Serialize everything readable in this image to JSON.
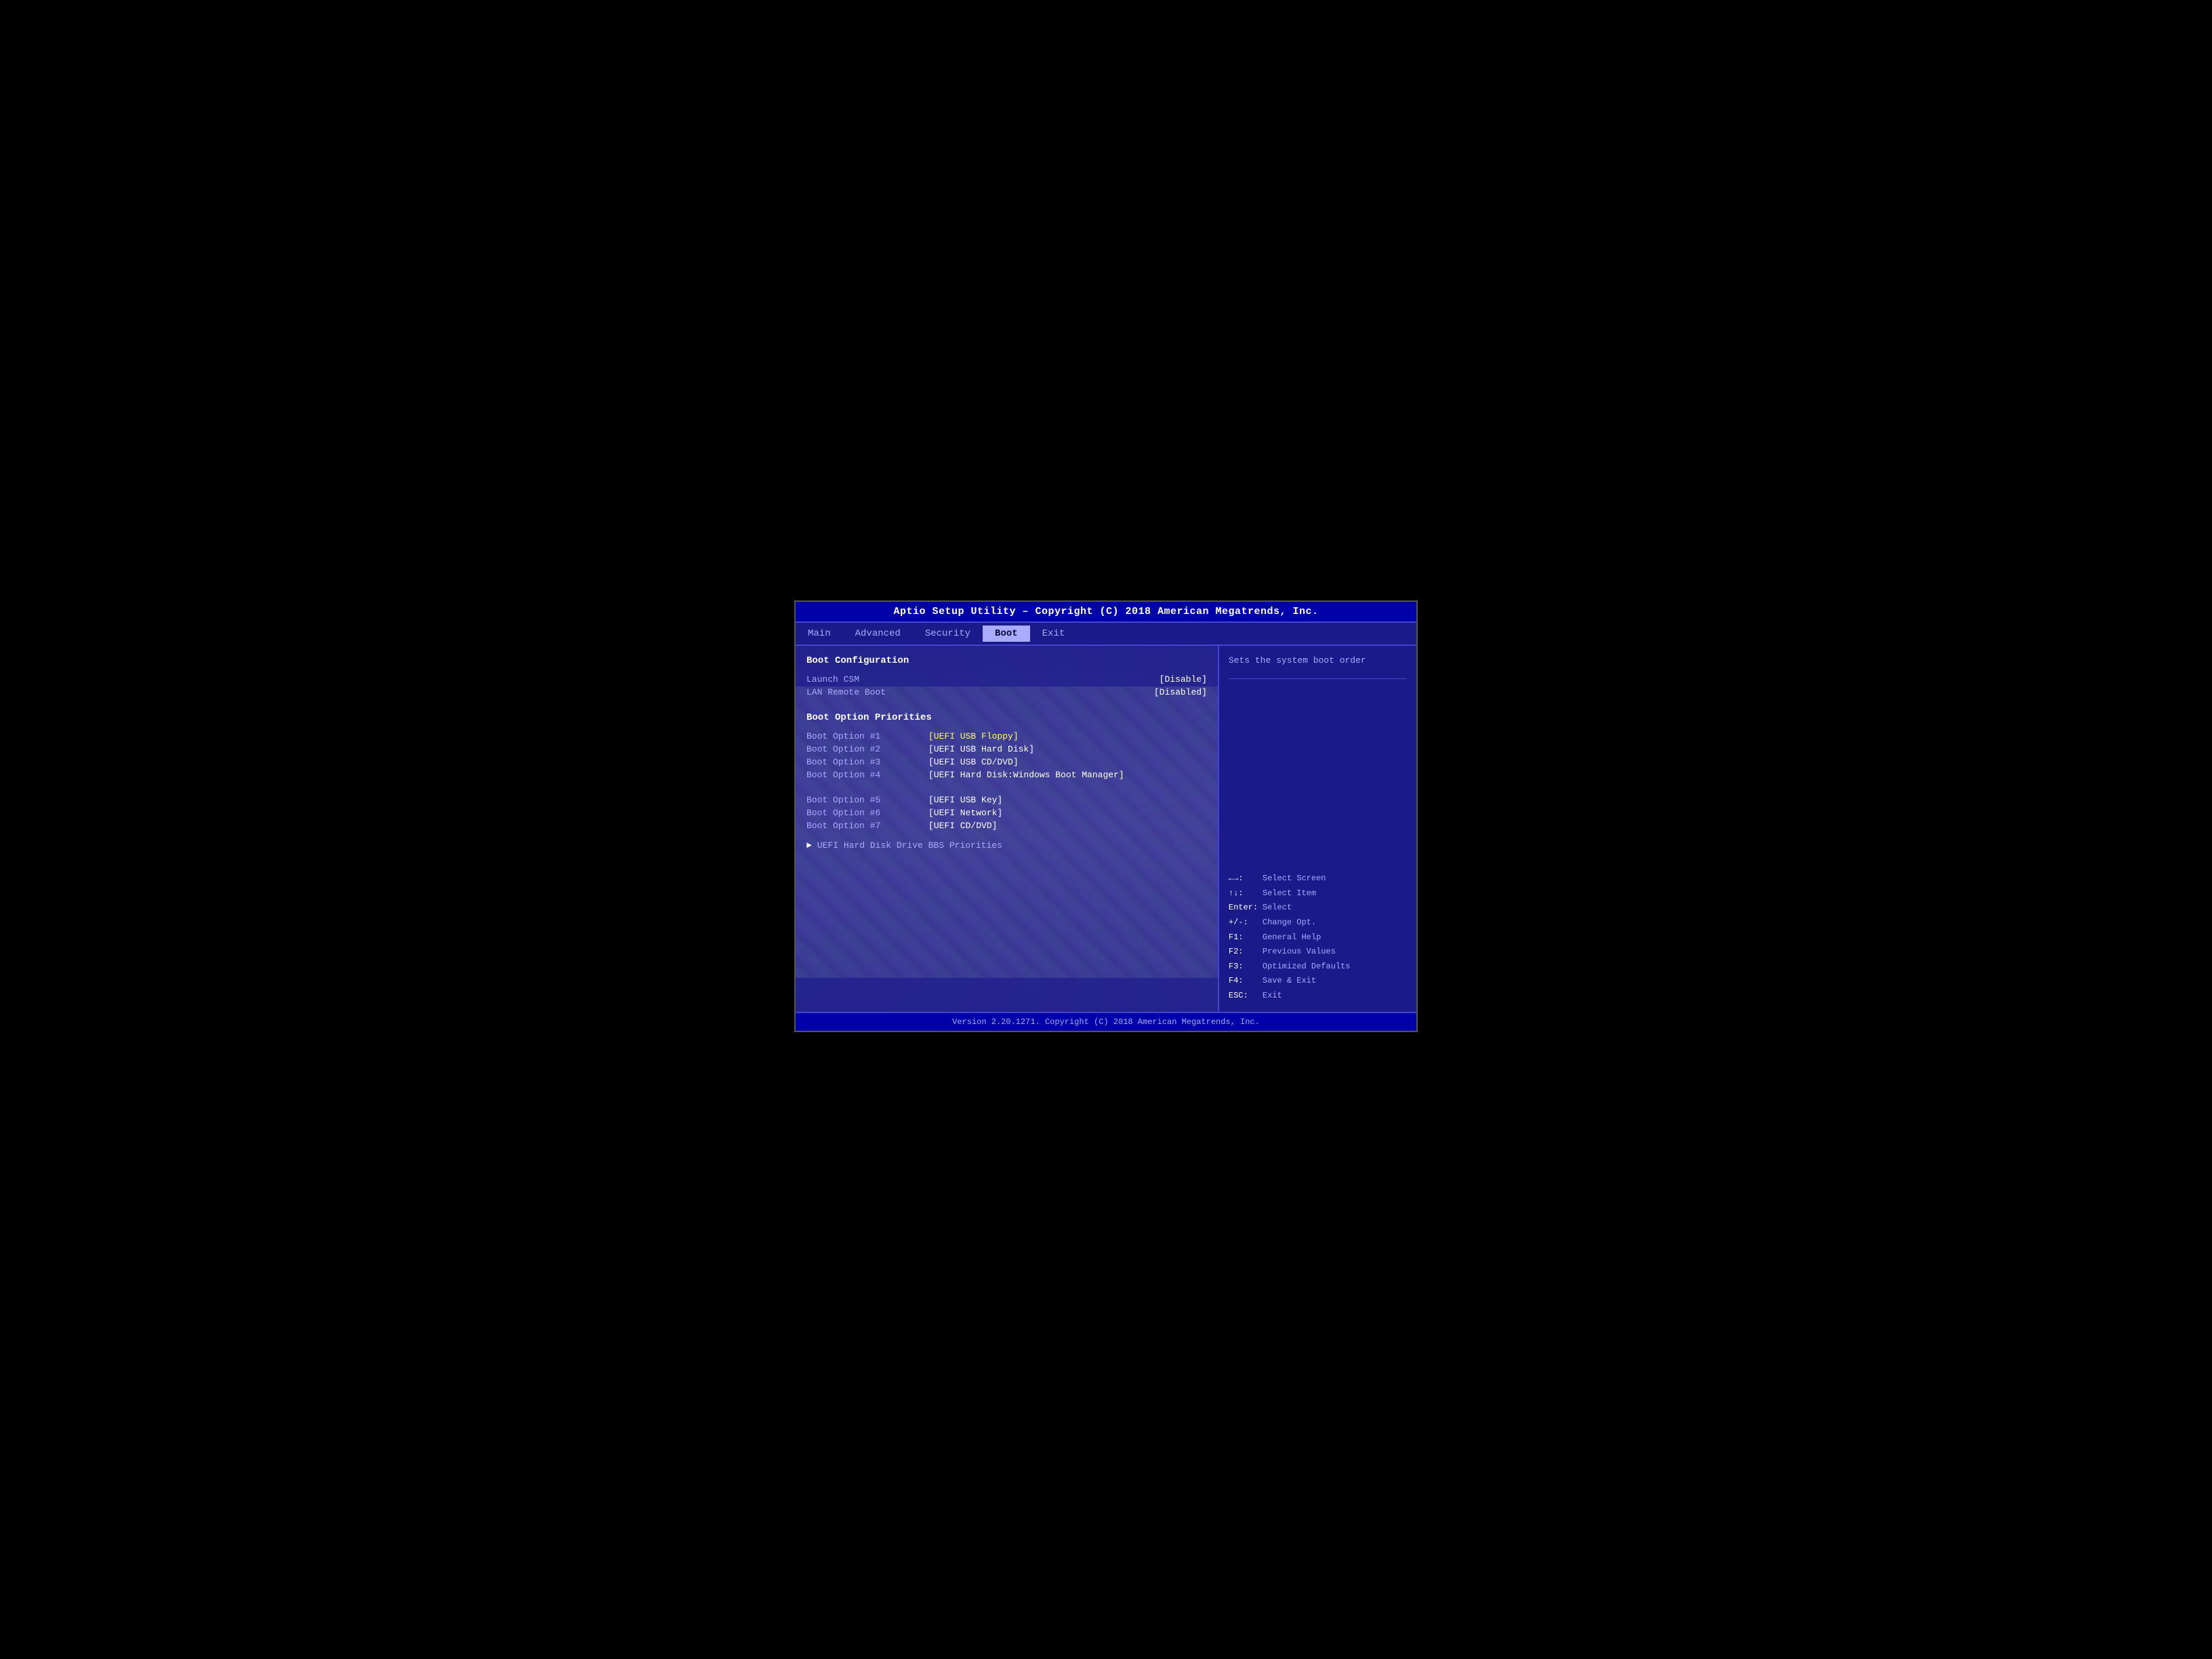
{
  "header": {
    "title": "Aptio Setup Utility – Copyright (C) 2018 American Megatrends, Inc."
  },
  "nav": {
    "items": [
      {
        "label": "Main",
        "active": false
      },
      {
        "label": "Advanced",
        "active": false
      },
      {
        "label": "Security",
        "active": false
      },
      {
        "label": "Boot",
        "active": true
      },
      {
        "label": "Exit",
        "active": false
      }
    ]
  },
  "main": {
    "section_title": "Boot Configuration",
    "launch_csm_label": "Launch CSM",
    "launch_csm_value": "[Disable]",
    "lan_remote_boot_label": "LAN Remote Boot",
    "lan_remote_boot_value": "[Disabled]",
    "boot_priorities_title": "Boot Option Priorities",
    "boot_options": [
      {
        "label": "Boot Option #1",
        "value": "[UEFI USB Floppy]",
        "highlight": true
      },
      {
        "label": "Boot Option #2",
        "value": "[UEFI USB Hard Disk]",
        "highlight": false
      },
      {
        "label": "Boot Option #3",
        "value": "[UEFI USB CD/DVD]",
        "highlight": false
      },
      {
        "label": "Boot Option #4",
        "value": "[UEFI Hard Disk:Windows Boot Manager]",
        "highlight": false
      },
      {
        "label": "Boot Option #5",
        "value": "[UEFI USB Key]",
        "highlight": false
      },
      {
        "label": "Boot Option #6",
        "value": "[UEFI Network]",
        "highlight": false
      },
      {
        "label": "Boot Option #7",
        "value": "[UEFI CD/DVD]",
        "highlight": false
      }
    ],
    "submenu_label": "UEFI Hard Disk Drive BBS Priorities"
  },
  "right": {
    "help_text": "Sets the system boot order",
    "shortcuts": [
      {
        "key": "←→:",
        "desc": "Select Screen"
      },
      {
        "key": "↑↓:",
        "desc": "Select Item"
      },
      {
        "key": "Enter:",
        "desc": "Select"
      },
      {
        "key": "+/-:",
        "desc": "Change Opt."
      },
      {
        "key": "F1:",
        "desc": "General Help"
      },
      {
        "key": "F2:",
        "desc": "Previous Values"
      },
      {
        "key": "F3:",
        "desc": "Optimized Defaults"
      },
      {
        "key": "F4:",
        "desc": "Save & Exit"
      },
      {
        "key": "ESC:",
        "desc": "Exit"
      }
    ]
  },
  "footer": {
    "text": "Version 2.20.1271. Copyright (C) 2018 American Megatrends, Inc."
  }
}
